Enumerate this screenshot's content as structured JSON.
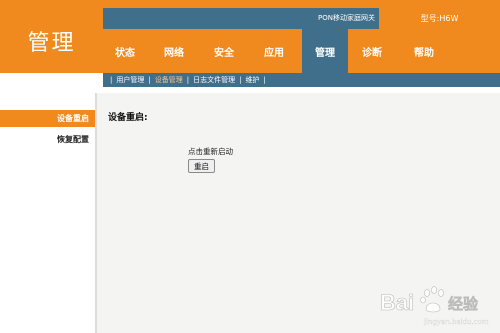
{
  "brand": {
    "title": "管理"
  },
  "header": {
    "device_name": "PON移动家庭网关",
    "model": "型号:H6W"
  },
  "nav": [
    {
      "label": "状态",
      "active": false
    },
    {
      "label": "网络",
      "active": false
    },
    {
      "label": "安全",
      "active": false
    },
    {
      "label": "应用",
      "active": false
    },
    {
      "label": "管理",
      "active": true
    },
    {
      "label": "诊断",
      "active": false
    },
    {
      "label": "帮助",
      "active": false
    }
  ],
  "subnav": [
    {
      "label": "用户管理",
      "active": false
    },
    {
      "label": "设备管理",
      "active": true
    },
    {
      "label": "日志文件管理",
      "active": false
    },
    {
      "label": "维护",
      "active": false
    }
  ],
  "sidebar": [
    {
      "label": "设备重启",
      "active": true
    },
    {
      "label": "恢复配置",
      "active": false
    }
  ],
  "content": {
    "title": "设备重启:",
    "hint": "点击重新启动",
    "button": "重启"
  },
  "watermark": {
    "text": "Bai 经验",
    "sub": "jingyan.baidu.com"
  },
  "colors": {
    "orange": "#f08a1e",
    "blue": "#3f6f8a",
    "content_bg": "#f4f4f2"
  }
}
